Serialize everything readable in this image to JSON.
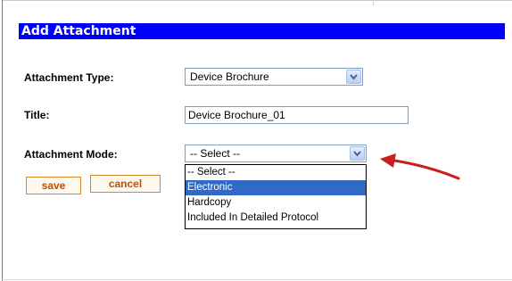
{
  "form": {
    "title": "Add Attachment",
    "attachment_type": {
      "label": "Attachment Type:",
      "value": "Device Brochure"
    },
    "title_field": {
      "label": "Title:",
      "value": "Device Brochure_01"
    },
    "attachment_mode": {
      "label": "Attachment Mode:",
      "value": "-- Select --",
      "options": [
        "-- Select --",
        "Electronic",
        "Hardcopy",
        "Included In Detailed Protocol"
      ],
      "highlighted_option": "Electronic"
    },
    "save_label": "save",
    "cancel_label": "cancel"
  },
  "icons": {
    "dropdown": "chevron-down-icon",
    "annotation": "red-arrow-icon"
  },
  "colors": {
    "header_bg": "#0000ff",
    "header_text": "#ffffff",
    "button_text": "#b5520e",
    "button_border": "#d48a2a",
    "highlight": "#316ac5",
    "arrow": "#c81e1e"
  }
}
